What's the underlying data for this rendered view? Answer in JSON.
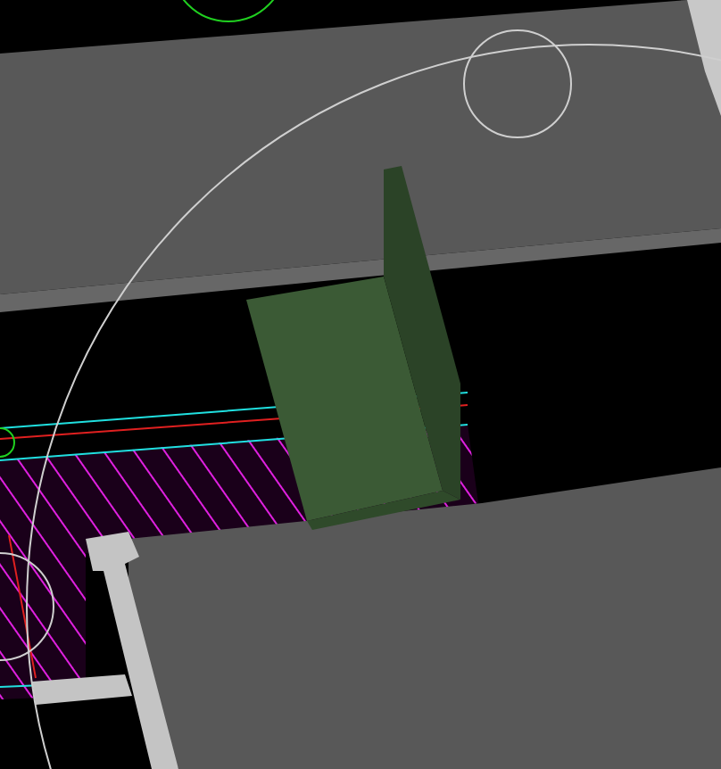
{
  "viewport": {
    "shaded": true
  }
}
